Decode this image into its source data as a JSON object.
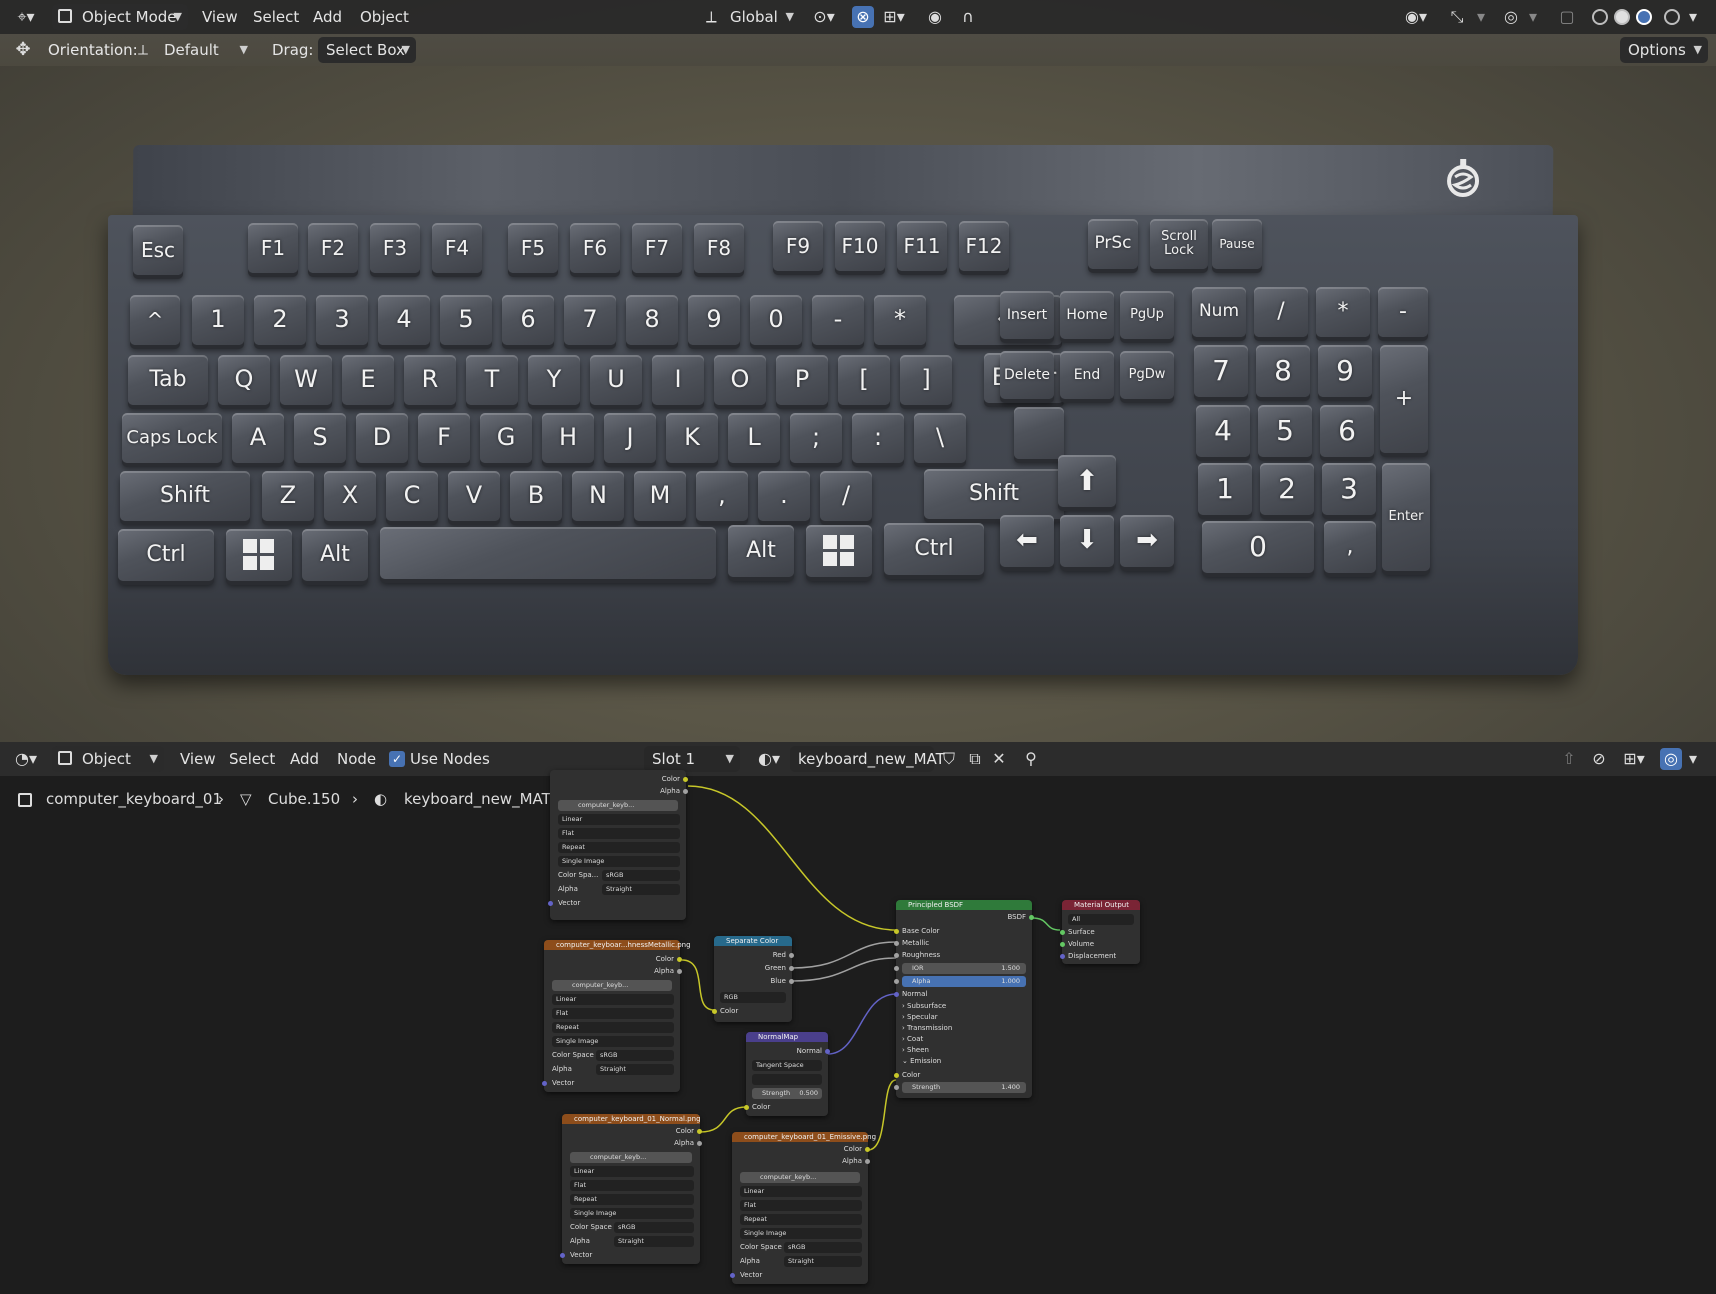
{
  "viewport": {
    "header": {
      "mode": "Object Mode",
      "menus": [
        "View",
        "Select",
        "Add",
        "Object"
      ],
      "transform_orientation": "Global"
    },
    "toolbar": {
      "orientation_label": "Orientation:",
      "orientation_value": "Default",
      "drag_label": "Drag:",
      "drag_value": "Select Box",
      "options_label": "Options"
    },
    "keyboard": {
      "row_fn": [
        "Esc",
        "F1",
        "F2",
        "F3",
        "F4",
        "F5",
        "F6",
        "F7",
        "F8",
        "F9",
        "F10",
        "F11",
        "F12",
        "PrSc",
        "Scroll Lock",
        "Pause"
      ],
      "row_num": [
        "^",
        "1",
        "2",
        "3",
        "4",
        "5",
        "6",
        "7",
        "8",
        "9",
        "0",
        "-",
        "*",
        "⬅"
      ],
      "row_q": [
        "Tab",
        "Q",
        "W",
        "E",
        "R",
        "T",
        "Y",
        "U",
        "I",
        "O",
        "P",
        "[",
        "]",
        "Enter"
      ],
      "row_a": [
        "Caps Lock",
        "A",
        "S",
        "D",
        "F",
        "G",
        "H",
        "J",
        "K",
        "L",
        ";",
        ":",
        "\\"
      ],
      "row_z": [
        "Shift",
        "Z",
        "X",
        "C",
        "V",
        "B",
        "N",
        "M",
        ",",
        ".",
        "/",
        "Shift"
      ],
      "row_bottom": [
        "Ctrl",
        "Alt",
        "Alt",
        "Ctrl"
      ],
      "nav": [
        "Insert",
        "Home",
        "PgUp",
        "Delete",
        "End",
        "PgDw"
      ],
      "arrows": [
        "⬆",
        "⬅",
        "⬇",
        "➡"
      ],
      "numpad": [
        "Num",
        "/",
        "*",
        "-",
        "7",
        "8",
        "9",
        "+",
        "4",
        "5",
        "6",
        "1",
        "2",
        "3",
        "Enter",
        "0",
        ","
      ]
    }
  },
  "node_editor": {
    "header": {
      "type": "Object",
      "menus": [
        "View",
        "Select",
        "Add",
        "Node"
      ],
      "use_nodes_label": "Use Nodes",
      "slot": "Slot 1",
      "material": "keyboard_new_MAT"
    },
    "breadcrumb": [
      "computer_keyboard_01",
      "Cube.150",
      "keyboard_new_MAT"
    ],
    "image_node_fields": {
      "image": "computer_keyb...",
      "interpolation": "Linear",
      "projection": "Flat",
      "extension": "Repeat",
      "source": "Single Image",
      "color_space_label": "Color Space",
      "color_space_short": "Color Spa...",
      "color_space": "sRGB",
      "alpha_label": "Alpha",
      "alpha_mode": "Straight",
      "vector_label": "Vector",
      "out_color": "Color",
      "out_alpha": "Alpha"
    },
    "nodes": {
      "metallic_title": "computer_keyboar...hnessMetallic.png",
      "normal_tex_title": "computer_keyboard_01_Normal.png",
      "emissive_title": "computer_keyboard_01_Emissive.png",
      "separate": {
        "title": "Separate Color",
        "outputs": [
          "Red",
          "Green",
          "Blue"
        ],
        "mode": "RGB",
        "input": "Color"
      },
      "normal_map": {
        "title": "NormalMap",
        "output": "Normal",
        "space": "Tangent Space",
        "strength_label": "Strength",
        "strength": "0.500",
        "input": "Color"
      },
      "bsdf": {
        "title": "Principled BSDF",
        "output": "BSDF",
        "inputs": [
          "Base Color",
          "Metallic",
          "Roughness"
        ],
        "ior_label": "IOR",
        "ior": "1.500",
        "alpha_label": "Alpha",
        "alpha": "1.000",
        "normal": "Normal",
        "panels": [
          "Subsurface",
          "Specular",
          "Transmission",
          "Coat",
          "Sheen",
          "Emission"
        ],
        "emission_color": "Color",
        "emission_strength_label": "Strength",
        "emission_strength": "1.400"
      },
      "output": {
        "title": "Material Output",
        "target": "All",
        "inputs": [
          "Surface",
          "Volume",
          "Displacement"
        ]
      }
    }
  }
}
